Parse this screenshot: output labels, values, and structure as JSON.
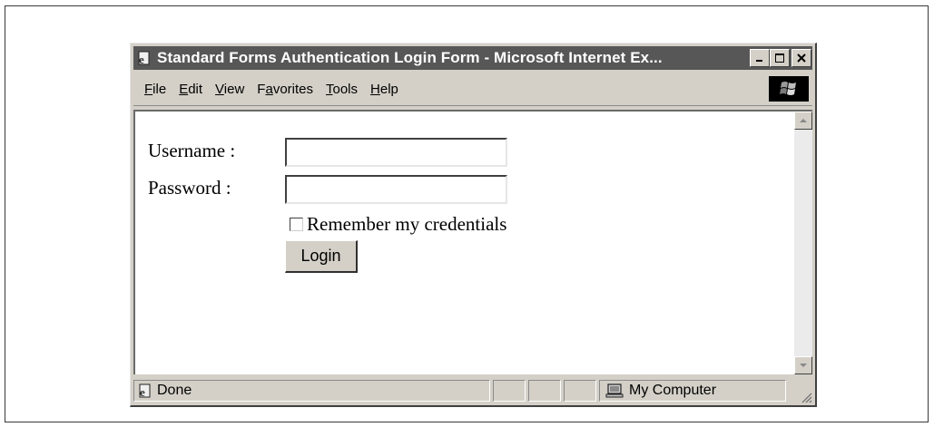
{
  "window": {
    "title": "Standard Forms Authentication Login Form - Microsoft Internet Ex...",
    "minimize_label": "_",
    "maximize_label": "□",
    "close_label": "×"
  },
  "menu": {
    "items": [
      {
        "label": "File",
        "accel": "F",
        "rest": "ile"
      },
      {
        "label": "Edit",
        "accel": "E",
        "rest": "dit"
      },
      {
        "label": "View",
        "accel": "V",
        "rest": "iew"
      },
      {
        "label": "Favorites",
        "pre": "F",
        "accel": "a",
        "rest": "vorites"
      },
      {
        "label": "Tools",
        "accel": "T",
        "rest": "ools"
      },
      {
        "label": "Help",
        "accel": "H",
        "rest": "elp"
      }
    ]
  },
  "form": {
    "username_label": "Username :",
    "password_label": "Password :",
    "username_value": "",
    "password_value": "",
    "remember_label": "Remember my credentials",
    "remember_checked": false,
    "login_label": "Login"
  },
  "status": {
    "text": "Done",
    "zone": "My Computer"
  },
  "icons": {
    "title": "ie-page-icon",
    "throbber": "windows-logo-icon",
    "status": "ie-page-icon",
    "zone": "computer-icon"
  }
}
